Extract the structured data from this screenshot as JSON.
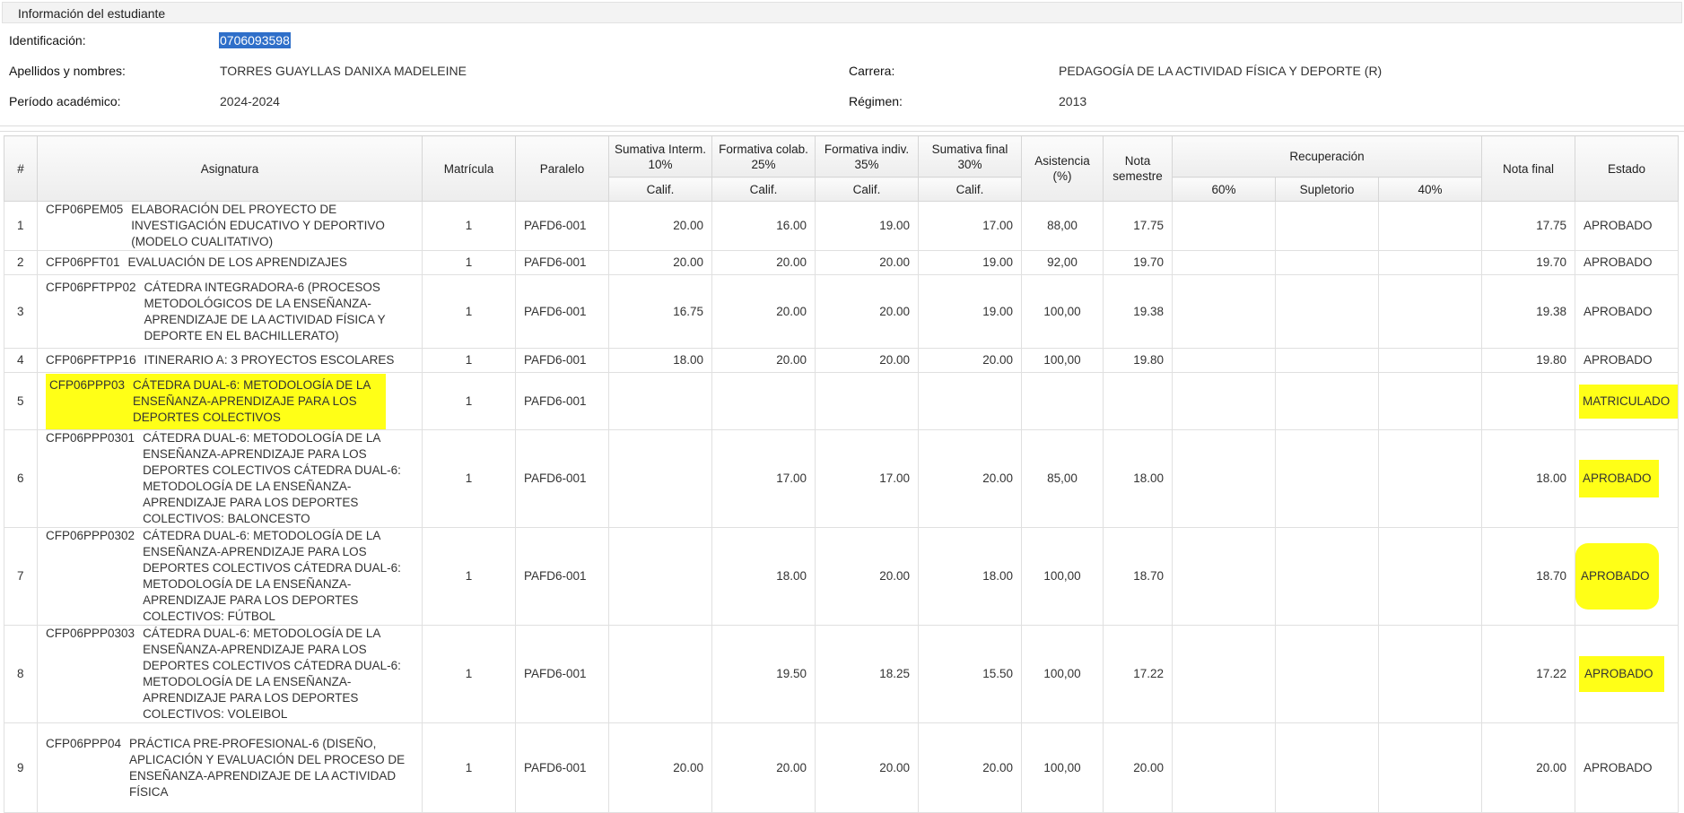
{
  "panel": {
    "title": "Información del estudiante"
  },
  "student": {
    "id_label": "Identificación:",
    "id_value": "0706093598",
    "name_label": "Apellidos y nombres:",
    "name_value": "TORRES GUAYLLAS DANIXA MADELEINE",
    "career_label": "Carrera:",
    "career_value": "PEDAGOGÍA DE LA ACTIVIDAD FÍSICA Y DEPORTE (R)",
    "period_label": "Período académico:",
    "period_value": "2024-2024",
    "regime_label": "Régimen:",
    "regime_value": "2013"
  },
  "table": {
    "headers": {
      "num": "#",
      "subject": "Asignatura",
      "enrollment": "Matrícula",
      "parallel": "Paralelo",
      "sum_interm": "Sumativa Interm. 10%",
      "form_colab": "Formativa colab. 25%",
      "form_indiv": "Formativa indiv. 35%",
      "sum_final": "Sumativa final 30%",
      "attendance": "Asistencia (%)",
      "semester_grade": "Nota semestre",
      "recovery": "Recuperación",
      "final_grade": "Nota final",
      "status": "Estado"
    },
    "subheaders": {
      "calif": "Calif.",
      "r60": "60%",
      "supletorio": "Supletorio",
      "r40": "40%"
    },
    "rows": [
      {
        "num": "1",
        "code": "CFP06PEM05",
        "name": "ELABORACIÓN DEL PROYECTO DE INVESTIGACIÓN EDUCATIVO Y DEPORTIVO (MODELO CUALITATIVO)",
        "matricula": "1",
        "paralelo": "PAFD6-001",
        "s_interm": "20.00",
        "f_colab": "16.00",
        "f_indiv": "19.00",
        "s_final": "17.00",
        "asistencia": "88,00",
        "nota_sem": "17.75",
        "nota_final": "17.75",
        "estado": "APROBADO"
      },
      {
        "num": "2",
        "code": "CFP06PFT01",
        "name": "EVALUACIÓN DE LOS APRENDIZAJES",
        "matricula": "1",
        "paralelo": "PAFD6-001",
        "s_interm": "20.00",
        "f_colab": "20.00",
        "f_indiv": "20.00",
        "s_final": "19.00",
        "asistencia": "92,00",
        "nota_sem": "19.70",
        "nota_final": "19.70",
        "estado": "APROBADO"
      },
      {
        "num": "3",
        "code": "CFP06PFTPP02",
        "name": "CÁTEDRA INTEGRADORA-6 (PROCESOS METODOLÓGICOS DE LA ENSEÑANZA-APRENDIZAJE DE LA ACTIVIDAD FÍSICA Y DEPORTE EN EL BACHILLERATO)",
        "matricula": "1",
        "paralelo": "PAFD6-001",
        "s_interm": "16.75",
        "f_colab": "20.00",
        "f_indiv": "20.00",
        "s_final": "19.00",
        "asistencia": "100,00",
        "nota_sem": "19.38",
        "nota_final": "19.38",
        "estado": "APROBADO"
      },
      {
        "num": "4",
        "code": "CFP06PFTPP16",
        "name": "ITINERARIO A: 3 PROYECTOS ESCOLARES",
        "matricula": "1",
        "paralelo": "PAFD6-001",
        "s_interm": "18.00",
        "f_colab": "20.00",
        "f_indiv": "20.00",
        "s_final": "20.00",
        "asistencia": "100,00",
        "nota_sem": "19.80",
        "nota_final": "19.80",
        "estado": "APROBADO"
      },
      {
        "num": "5",
        "code": "CFP06PPP03",
        "name": "CÁTEDRA DUAL-6: METODOLOGÍA DE LA ENSEÑANZA-APRENDIZAJE PARA LOS DEPORTES COLECTIVOS",
        "matricula": "1",
        "paralelo": "PAFD6-001",
        "s_interm": "",
        "f_colab": "",
        "f_indiv": "",
        "s_final": "",
        "asistencia": "",
        "nota_sem": "",
        "nota_final": "",
        "estado": "MATRICULADO"
      },
      {
        "num": "6",
        "code": "CFP06PPP0301",
        "name": "CÁTEDRA DUAL-6: METODOLOGÍA DE LA ENSEÑANZA-APRENDIZAJE PARA LOS DEPORTES COLECTIVOS CÁTEDRA DUAL-6: METODOLOGÍA DE LA ENSEÑANZA-APRENDIZAJE PARA LOS DEPORTES COLECTIVOS: BALONCESTO",
        "matricula": "1",
        "paralelo": "PAFD6-001",
        "s_interm": "",
        "f_colab": "17.00",
        "f_indiv": "17.00",
        "s_final": "20.00",
        "asistencia": "85,00",
        "nota_sem": "18.00",
        "nota_final": "18.00",
        "estado": "APROBADO"
      },
      {
        "num": "7",
        "code": "CFP06PPP0302",
        "name": "CÁTEDRA DUAL-6: METODOLOGÍA DE LA ENSEÑANZA-APRENDIZAJE PARA LOS DEPORTES COLECTIVOS CÁTEDRA DUAL-6: METODOLOGÍA DE LA ENSEÑANZA-APRENDIZAJE PARA LOS DEPORTES COLECTIVOS: FÚTBOL",
        "matricula": "1",
        "paralelo": "PAFD6-001",
        "s_interm": "",
        "f_colab": "18.00",
        "f_indiv": "20.00",
        "s_final": "18.00",
        "asistencia": "100,00",
        "nota_sem": "18.70",
        "nota_final": "18.70",
        "estado": "APROBADO"
      },
      {
        "num": "8",
        "code": "CFP06PPP0303",
        "name": "CÁTEDRA DUAL-6: METODOLOGÍA DE LA ENSEÑANZA-APRENDIZAJE PARA LOS DEPORTES COLECTIVOS CÁTEDRA DUAL-6: METODOLOGÍA DE LA ENSEÑANZA-APRENDIZAJE PARA LOS DEPORTES COLECTIVOS: VOLEIBOL",
        "matricula": "1",
        "paralelo": "PAFD6-001",
        "s_interm": "",
        "f_colab": "19.50",
        "f_indiv": "18.25",
        "s_final": "15.50",
        "asistencia": "100,00",
        "nota_sem": "17.22",
        "nota_final": "17.22",
        "estado": "APROBADO"
      },
      {
        "num": "9",
        "code": "CFP06PPP04",
        "name": "PRÁCTICA PRE-PROFESIONAL-6 (DISEÑO, APLICACIÓN Y EVALUACIÓN DEL PROCESO DE ENSEÑANZA-APRENDIZAJE DE LA ACTIVIDAD FÍSICA",
        "matricula": "1",
        "paralelo": "PAFD6-001",
        "s_interm": "20.00",
        "f_colab": "20.00",
        "f_indiv": "20.00",
        "s_final": "20.00",
        "asistencia": "100,00",
        "nota_sem": "20.00",
        "nota_final": "20.00",
        "estado": "APROBADO"
      }
    ]
  },
  "highlight_color": "#ffff17",
  "selection_color": "#2f6fc9"
}
